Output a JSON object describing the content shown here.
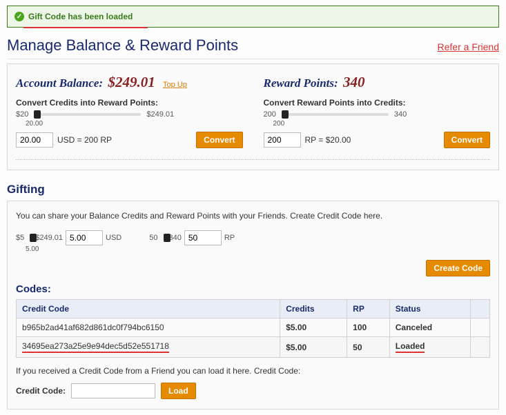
{
  "alert": {
    "text": "Gift Code has been loaded"
  },
  "page": {
    "title": "Manage Balance & Reward Points",
    "refer": "Refer a Friend"
  },
  "balance": {
    "label": "Account Balance:",
    "value": "$249.01",
    "topup": "Top Up",
    "convert_label": "Convert Credits into Reward Points:",
    "slider_min": "$20",
    "slider_max": "$249.01",
    "slider_cur": "20.00",
    "input_val": "20.00",
    "equals": "USD = 200 RP",
    "btn": "Convert"
  },
  "reward": {
    "label": "Reward Points:",
    "value": "340",
    "convert_label": "Convert Reward Points into Credits:",
    "slider_min": "200",
    "slider_max": "340",
    "slider_cur": "200",
    "input_val": "200",
    "equals": "RP = $20.00",
    "btn": "Convert"
  },
  "gifting": {
    "title": "Gifting",
    "intro": "You can share your Balance Credits and Reward Points with your Friends. Create Credit Code here.",
    "usd_slider": {
      "min": "$5",
      "max": "$249.01",
      "cur": "5.00",
      "val": "5.00",
      "unit": "USD"
    },
    "rp_slider": {
      "min": "50",
      "max": "340",
      "cur": "",
      "val": "50",
      "unit": "RP"
    },
    "create_btn": "Create Code",
    "codes_title": "Codes:",
    "headers": {
      "code": "Credit Code",
      "credits": "Credits",
      "rp": "RP",
      "status": "Status"
    },
    "rows": [
      {
        "code": "b965b2ad41af682d861dc0f794bc6150",
        "credits": "$5.00",
        "rp": "100",
        "status": "Canceled"
      },
      {
        "code": "34695ea273a25e9e94dec5d52e551718",
        "credits": "$5.00",
        "rp": "50",
        "status": "Loaded"
      }
    ],
    "load_intro": "If you received a Credit Code from a Friend you can load it here. Credit Code:",
    "load_label": "Credit Code:",
    "load_btn": "Load"
  }
}
